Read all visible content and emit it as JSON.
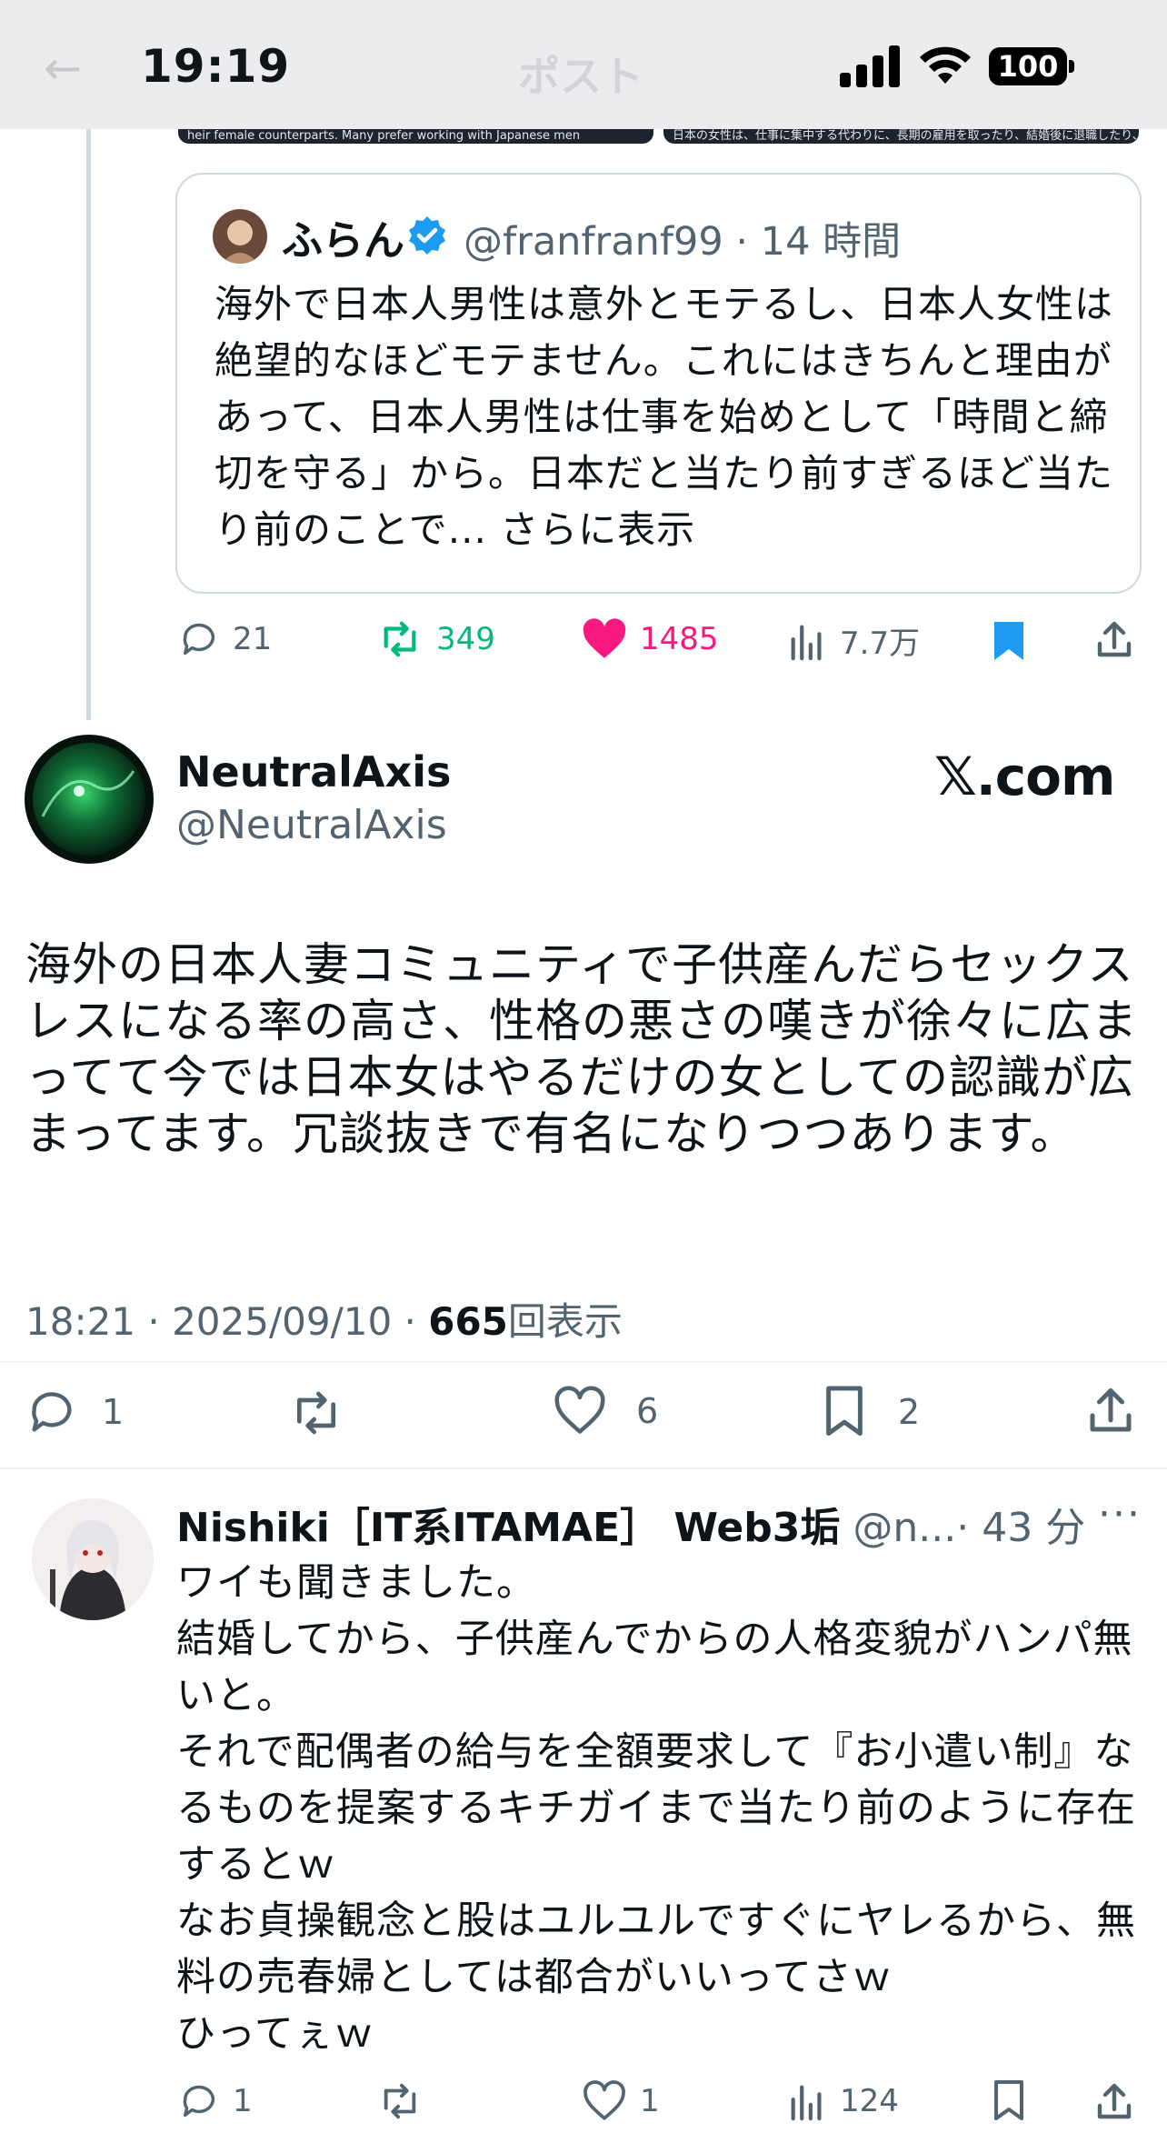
{
  "status_bar": {
    "time": "19:19",
    "battery": "100",
    "ghost_back": "←",
    "ghost_title": "ポスト"
  },
  "top_images": {
    "left_caption": "heir female counterparts. Many prefer working with Japanese men",
    "right_caption": "日本の女性は、仕事に集中する代わりに、長期の雇用を取ったり、結婚後に退職したり、職場で男性、特に白人男性と浮気をしたりすることがあ"
  },
  "quoted_post": {
    "name": "ふらん",
    "handle": "@franfranf99",
    "time": "14 時間",
    "text": "海外で日本人男性は意外とモテるし、日本人女性は絶望的なほどモテません。これにはきちんと理由があって、日本人男性は仕事を始めとして「時間と締切を守る」から。日本だと当たり前すぎるほど当たり前のことで...",
    "show_more": "さらに表示"
  },
  "parent_actions": {
    "replies": "21",
    "reposts": "349",
    "likes": "1485",
    "views": "7.7万"
  },
  "main_post": {
    "name": "NeutralAxis",
    "handle": "@NeutralAxis",
    "brand": "𝕏.com",
    "text": "海外の日本人妻コミュニティで子供産んだらセックスレスになる率の高さ、性格の悪さの嘆きが徐々に広まってて今では日本女はやるだけの女としての認識が広まってます。冗談抜きで有名になりつつあります。",
    "timestamp": "18:21 · 2025/09/10 · ",
    "views_count": "665",
    "views_label": "回表示",
    "actions": {
      "replies": "1",
      "likes": "6",
      "bookmarks": "2"
    }
  },
  "reply": {
    "name": "Nishiki［IT系ITAMAE］ Web3垢",
    "handle": "@n...",
    "time": "· 43 分",
    "more": "···",
    "text": "ワイも聞きました。\n結婚してから、子供産んでからの人格変貌がハンパ無いと。\nそれで配偶者の給与を全額要求して『お小遣い制』なるものを提案するキチガイまで当たり前のように存在するとｗ\nなお貞操観念と股はユルユルですぐにヤレるから、無料の売春婦としては都合がいいってさｗ\nひってぇｗ",
    "actions": {
      "replies": "1",
      "likes": "1",
      "views": "124"
    }
  },
  "colors": {
    "accent": "#1d9bf0",
    "like": "#f91880",
    "repost": "#00ba7c",
    "secondary": "#536471"
  }
}
